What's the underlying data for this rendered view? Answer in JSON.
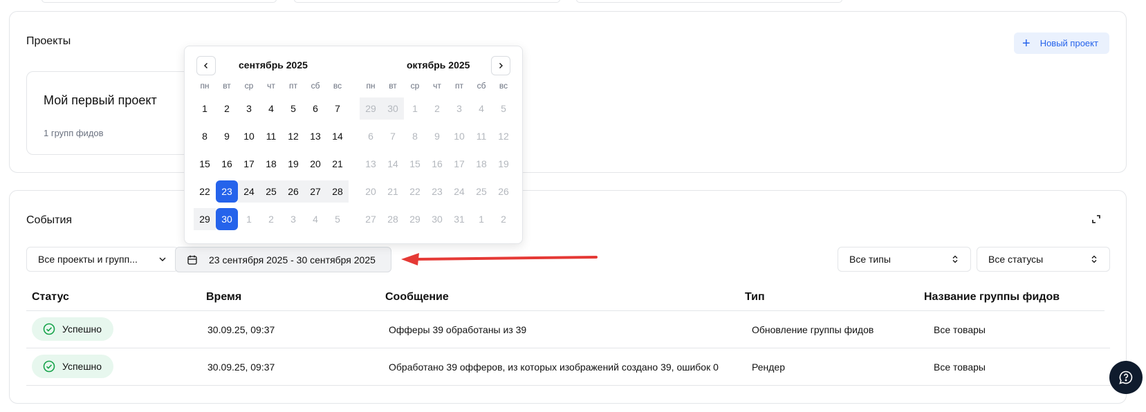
{
  "projects": {
    "title": "Проекты",
    "new_project_label": "Новый проект",
    "card": {
      "name": "Мой первый проект",
      "meta": "1 групп фидов"
    }
  },
  "events": {
    "title": "События",
    "filter_projects": "Все проекты и групп...",
    "date_range": "23 сентября 2025 - 30 сентября 2025",
    "filter_types": "Все типы",
    "filter_statuses": "Все статусы",
    "columns": [
      "Статус",
      "Время",
      "Сообщение",
      "Тип",
      "Название группы фидов"
    ],
    "rows": [
      {
        "status": "Успешно",
        "time": "30.09.25, 09:37",
        "message": "Офферы 39 обработаны из 39",
        "type": "Обновление группы фидов",
        "group": "Все товары"
      },
      {
        "status": "Успешно",
        "time": "30.09.25, 09:37",
        "message": "Обработано 39 офферов, из которых изображений создано 39, ошибок 0",
        "type": "Рендер",
        "group": "Все товары"
      }
    ]
  },
  "calendar": {
    "left_month": "сентябрь 2025",
    "right_month": "октябрь 2025",
    "weekdays": [
      "пн",
      "вт",
      "ср",
      "чт",
      "пт",
      "сб",
      "вс"
    ],
    "left_days": [
      "1",
      "2",
      "3",
      "4",
      "5",
      "6",
      "7",
      "8",
      "9",
      "10",
      "11",
      "12",
      "13",
      "14",
      "15",
      "16",
      "17",
      "18",
      "19",
      "20",
      "21",
      "22",
      "23",
      "24",
      "25",
      "26",
      "27",
      "28",
      "29",
      "30",
      "1",
      "2",
      "3",
      "4",
      "5"
    ],
    "right_days": [
      "29",
      "30",
      "1",
      "2",
      "3",
      "4",
      "5",
      "6",
      "7",
      "8",
      "9",
      "10",
      "11",
      "12",
      "13",
      "14",
      "15",
      "16",
      "17",
      "18",
      "19",
      "20",
      "21",
      "22",
      "23",
      "24",
      "25",
      "26",
      "27",
      "28",
      "29",
      "30",
      "31",
      "1",
      "2"
    ],
    "selected_start": "23",
    "selected_end": "30"
  },
  "colors": {
    "accent": "#2563eb",
    "success_bg": "#e7f7ee",
    "success": "#16a34a",
    "arrow": "#e53935"
  }
}
